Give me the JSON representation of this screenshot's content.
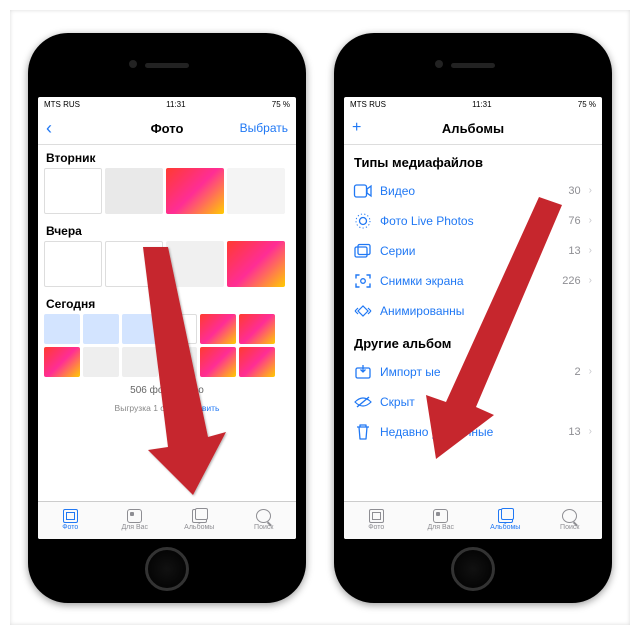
{
  "status": {
    "carrier": "MTS RUS",
    "time": "11:31",
    "battery": "75 %"
  },
  "phone1": {
    "nav": {
      "back": "‹",
      "title": "Фото",
      "select": "Выбрать"
    },
    "sections": {
      "tue": "Вторник",
      "yest": "Вчера",
      "today": "Сегодня"
    },
    "count": "506 фото видео",
    "upload": {
      "pre": "Выгрузка 1 объе",
      "stop": "становить"
    }
  },
  "phone2": {
    "nav": {
      "add": "+",
      "title": "Альбомы"
    },
    "media_header": "Типы медиафайлов",
    "rows": {
      "video": {
        "label": "Видео",
        "count": "30"
      },
      "live": {
        "label": "Фото Live Photos",
        "count": "76"
      },
      "burst": {
        "label": "Серии",
        "count": "13"
      },
      "screens": {
        "label": "Снимки экрана",
        "count": "226"
      },
      "anim": {
        "label": "Анимированны"
      }
    },
    "other_header": "Другие альбом",
    "rows2": {
      "import": {
        "label": "Импорт       ые",
        "count": "2"
      },
      "hidden": {
        "label": "Скрыт",
        "count": ""
      },
      "deleted": {
        "label": "Недавно удаленные",
        "count": "13"
      }
    }
  },
  "tabs": {
    "photos": "Фото",
    "foryou": "Для Вас",
    "albums": "Альбомы",
    "search": "Поиск"
  }
}
